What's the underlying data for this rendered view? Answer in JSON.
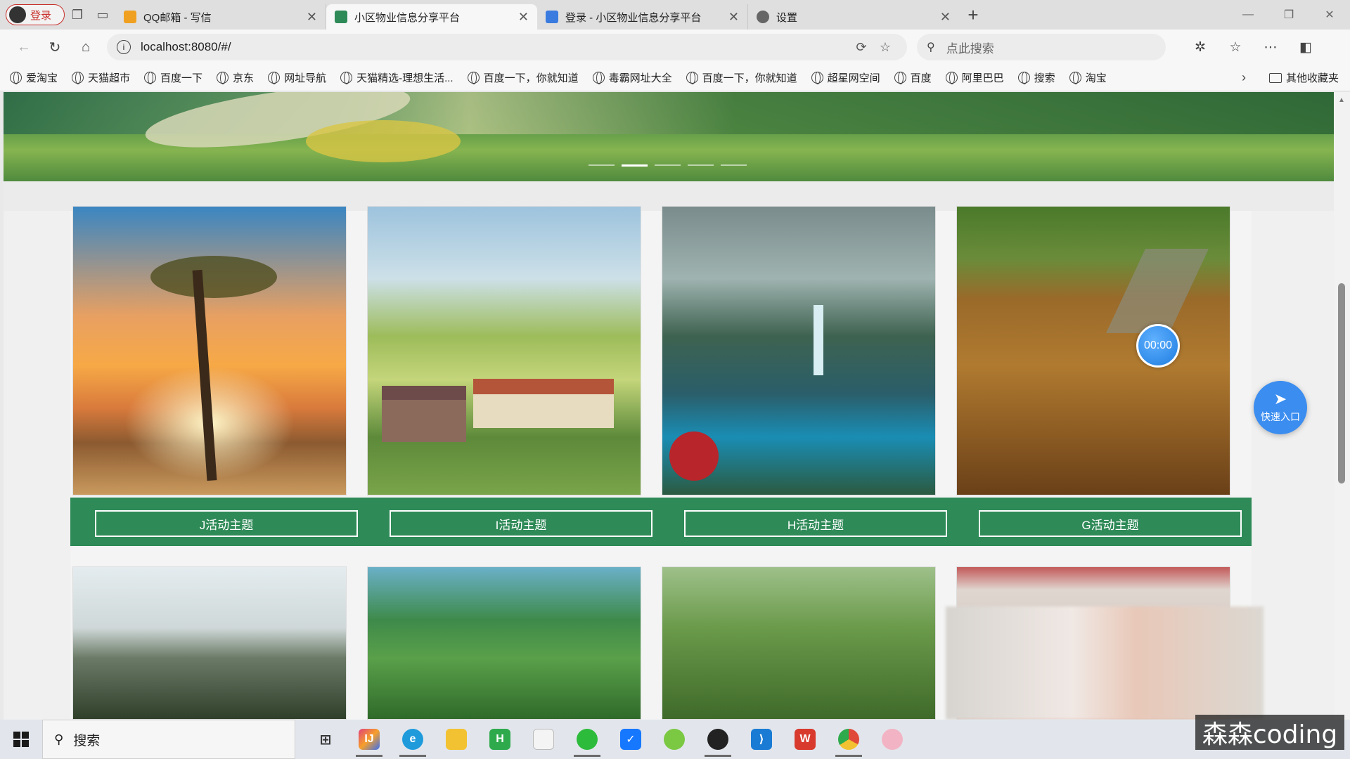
{
  "browser": {
    "profile_label": "登录",
    "tabs": [
      {
        "title": "QQ邮箱 - 写信",
        "active": false,
        "favicon_color": "#f0a020"
      },
      {
        "title": "小区物业信息分享平台",
        "active": true,
        "favicon_color": "#2e8a57"
      },
      {
        "title": "登录 - 小区物业信息分享平台",
        "active": false,
        "favicon_color": "#3a7be0"
      },
      {
        "title": "设置",
        "active": false,
        "favicon_color": "#666666"
      }
    ],
    "close_glyph": "✕",
    "new_tab_glyph": "+",
    "url": "localhost:8080/#/",
    "search_placeholder": "点此搜索",
    "bookmarks": [
      "爱淘宝",
      "天猫超市",
      "百度一下",
      "京东",
      "网址导航",
      "天猫精选-理想生活...",
      "百度一下，你就知道",
      "毒霸网址大全",
      "百度一下，你就知道",
      "超星网空间",
      "百度",
      "阿里巴巴",
      "搜索",
      "淘宝"
    ],
    "other_bookmarks": "其他收藏夹"
  },
  "page": {
    "carousel_dot_count": 5,
    "carousel_active_index": 1,
    "activity_themes": [
      "J活动主题",
      "I活动主题",
      "H活动主题",
      "G活动主题"
    ],
    "timer": "00:00",
    "quick_entry": "快速入口",
    "theme_color": "#2e8a57",
    "accent_color": "#3b8df0"
  },
  "taskbar": {
    "search_label": "搜索",
    "apps": [
      "task-view",
      "intellij-idea",
      "edge",
      "file-explorer",
      "hbuilder",
      "notepad",
      "wechat",
      "task-app",
      "app-green",
      "qq",
      "vscode",
      "wps",
      "chrome",
      "app-avatar"
    ]
  },
  "watermark": "森森coding"
}
